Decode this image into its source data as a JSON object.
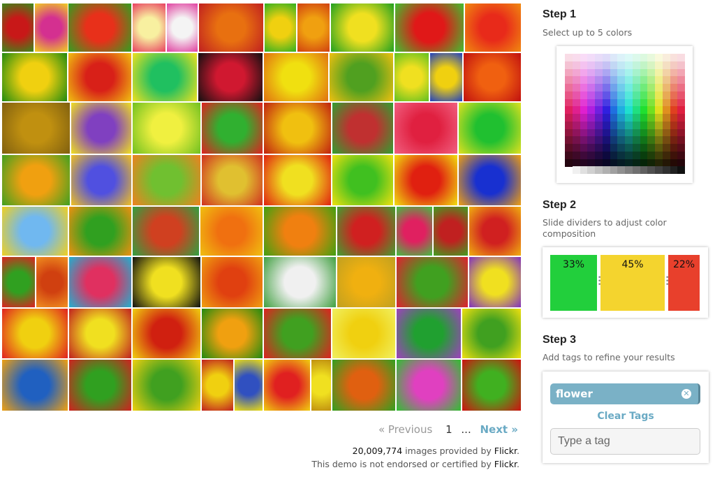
{
  "results": {
    "tiles": [
      [
        [
          "#c81818",
          "#3a8a1a"
        ],
        [
          "#d43090",
          "#f0d020"
        ],
        [
          "#e8301a",
          "#30a020"
        ],
        [
          "#f8f0a0",
          "#e84060"
        ],
        [
          "#f4f4f4",
          "#e040a0"
        ],
        [
          "#e87010",
          "#c02020"
        ],
        [
          "#f0d010",
          "#30b020"
        ],
        [
          "#f0a010",
          "#d04010"
        ],
        [
          "#f0e020",
          "#20a020"
        ],
        [
          "#e01818",
          "#40c030"
        ],
        [
          "#e82a1a",
          "#f08a10"
        ]
      ],
      [
        [
          "#f0d010",
          "#208a10"
        ],
        [
          "#d82018",
          "#f0c010"
        ],
        [
          "#20c060",
          "#f0e020"
        ],
        [
          "#d01830",
          "#101010"
        ],
        [
          "#f0e010",
          "#e07010"
        ],
        [
          "#50a020",
          "#f0c010"
        ],
        [
          "#f0e020",
          "#60c020"
        ],
        [
          "#f0d010",
          "#2040c0"
        ],
        [
          "#f06010",
          "#c01010"
        ]
      ],
      [
        [
          "#c09010",
          "#806010"
        ],
        [
          "#8040c0",
          "#f0e020"
        ],
        [
          "#f0f040",
          "#70c020"
        ],
        [
          "#30b030",
          "#e02020"
        ],
        [
          "#f0c010",
          "#c02010"
        ],
        [
          "#c03030",
          "#30a030"
        ],
        [
          "#e02040",
          "#f06080"
        ],
        [
          "#20c030",
          "#e0e020"
        ]
      ],
      [
        [
          "#f0a010",
          "#40a020"
        ],
        [
          "#5050e0",
          "#f0c020"
        ],
        [
          "#70c030",
          "#f08020"
        ],
        [
          "#e0c030",
          "#d03020"
        ],
        [
          "#f0e020",
          "#e02010"
        ],
        [
          "#40c020",
          "#f0e010"
        ],
        [
          "#e02010",
          "#f0e010"
        ],
        [
          "#1830d0",
          "#f0a010"
        ]
      ],
      [
        [
          "#70b8f0",
          "#f0d020"
        ],
        [
          "#30a020",
          "#f09010"
        ],
        [
          "#d04020",
          "#30a040"
        ],
        [
          "#f07010",
          "#f0c010"
        ],
        [
          "#f08010",
          "#40a010"
        ],
        [
          "#d02020",
          "#40a030"
        ],
        [
          "#e02060",
          "#40c040"
        ],
        [
          "#c02020",
          "#40a020"
        ],
        [
          "#d02020",
          "#f0b010"
        ]
      ],
      [
        [
          "#30a020",
          "#e02020"
        ],
        [
          "#d04010",
          "#f09020"
        ],
        [
          "#e03060",
          "#20b0d0"
        ],
        [
          "#f0e020",
          "#101010"
        ],
        [
          "#e04010",
          "#f0a010"
        ],
        [
          "#f0f0f0",
          "#40a040"
        ],
        [
          "#f0b010",
          "#c0a020"
        ],
        [
          "#40a020",
          "#e02030"
        ],
        [
          "#f0e020",
          "#8030c0"
        ]
      ],
      [
        [
          "#f0d010",
          "#e02020"
        ],
        [
          "#f0e020",
          "#c02020"
        ],
        [
          "#d02010",
          "#f0d010"
        ],
        [
          "#f0a010",
          "#208a10"
        ],
        [
          "#40a020",
          "#e02020"
        ],
        [
          "#f0d010",
          "#f0f060"
        ],
        [
          "#20a030",
          "#a040c0"
        ],
        [
          "#40a020",
          "#f0e010"
        ]
      ],
      [
        [
          "#2060c0",
          "#f0a010"
        ],
        [
          "#30a020",
          "#d02020"
        ],
        [
          "#40a020",
          "#f0d010"
        ],
        [
          "#f0d010",
          "#c02020"
        ],
        [
          "#3050c0",
          "#f0e010"
        ],
        [
          "#e02020",
          "#f0d010"
        ],
        [
          "#f0e020",
          "#c09010"
        ],
        [
          "#e06010",
          "#30a020"
        ],
        [
          "#e040c0",
          "#30c030"
        ],
        [
          "#40b020",
          "#d01010"
        ]
      ]
    ]
  },
  "pagination": {
    "previous": "« Previous",
    "current": "1",
    "ellipsis": "...",
    "next": "Next »"
  },
  "credits": {
    "count": "20,009,774",
    "line1_rest": " images provided by ",
    "provider": "Flickr",
    "period": ".",
    "line2": "This demo is not endorsed or certified by "
  },
  "step1": {
    "title": "Step 1",
    "subtitle": "Select up to 5 colors"
  },
  "step2": {
    "title": "Step 2",
    "subtitle": "Slide dividers to adjust color composition",
    "segments": [
      {
        "label": "33%",
        "percent": 33,
        "color": "#22cf3c"
      },
      {
        "label": "45%",
        "percent": 45,
        "color": "#f4d42e"
      },
      {
        "label": "22%",
        "percent": 22,
        "color": "#e8402c"
      }
    ]
  },
  "step3": {
    "title": "Step 3",
    "subtitle": "Add tags to refine your results",
    "tags": [
      {
        "label": "flower"
      }
    ],
    "clear_label": "Clear Tags",
    "input_placeholder": "Type a tag",
    "input_value": ""
  }
}
